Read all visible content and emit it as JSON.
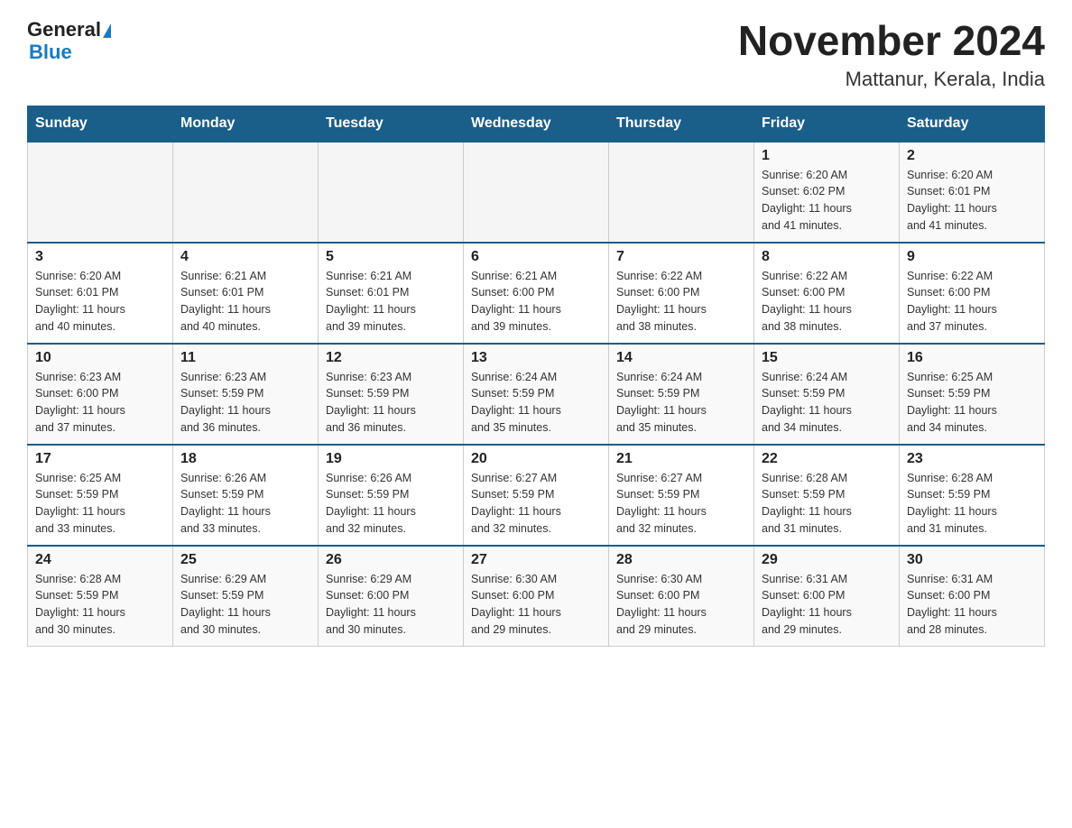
{
  "logo": {
    "text1": "General",
    "text2": "Blue"
  },
  "title": "November 2024",
  "subtitle": "Mattanur, Kerala, India",
  "weekdays": [
    "Sunday",
    "Monday",
    "Tuesday",
    "Wednesday",
    "Thursday",
    "Friday",
    "Saturday"
  ],
  "weeks": [
    [
      {
        "day": "",
        "info": ""
      },
      {
        "day": "",
        "info": ""
      },
      {
        "day": "",
        "info": ""
      },
      {
        "day": "",
        "info": ""
      },
      {
        "day": "",
        "info": ""
      },
      {
        "day": "1",
        "info": "Sunrise: 6:20 AM\nSunset: 6:02 PM\nDaylight: 11 hours\nand 41 minutes."
      },
      {
        "day": "2",
        "info": "Sunrise: 6:20 AM\nSunset: 6:01 PM\nDaylight: 11 hours\nand 41 minutes."
      }
    ],
    [
      {
        "day": "3",
        "info": "Sunrise: 6:20 AM\nSunset: 6:01 PM\nDaylight: 11 hours\nand 40 minutes."
      },
      {
        "day": "4",
        "info": "Sunrise: 6:21 AM\nSunset: 6:01 PM\nDaylight: 11 hours\nand 40 minutes."
      },
      {
        "day": "5",
        "info": "Sunrise: 6:21 AM\nSunset: 6:01 PM\nDaylight: 11 hours\nand 39 minutes."
      },
      {
        "day": "6",
        "info": "Sunrise: 6:21 AM\nSunset: 6:00 PM\nDaylight: 11 hours\nand 39 minutes."
      },
      {
        "day": "7",
        "info": "Sunrise: 6:22 AM\nSunset: 6:00 PM\nDaylight: 11 hours\nand 38 minutes."
      },
      {
        "day": "8",
        "info": "Sunrise: 6:22 AM\nSunset: 6:00 PM\nDaylight: 11 hours\nand 38 minutes."
      },
      {
        "day": "9",
        "info": "Sunrise: 6:22 AM\nSunset: 6:00 PM\nDaylight: 11 hours\nand 37 minutes."
      }
    ],
    [
      {
        "day": "10",
        "info": "Sunrise: 6:23 AM\nSunset: 6:00 PM\nDaylight: 11 hours\nand 37 minutes."
      },
      {
        "day": "11",
        "info": "Sunrise: 6:23 AM\nSunset: 5:59 PM\nDaylight: 11 hours\nand 36 minutes."
      },
      {
        "day": "12",
        "info": "Sunrise: 6:23 AM\nSunset: 5:59 PM\nDaylight: 11 hours\nand 36 minutes."
      },
      {
        "day": "13",
        "info": "Sunrise: 6:24 AM\nSunset: 5:59 PM\nDaylight: 11 hours\nand 35 minutes."
      },
      {
        "day": "14",
        "info": "Sunrise: 6:24 AM\nSunset: 5:59 PM\nDaylight: 11 hours\nand 35 minutes."
      },
      {
        "day": "15",
        "info": "Sunrise: 6:24 AM\nSunset: 5:59 PM\nDaylight: 11 hours\nand 34 minutes."
      },
      {
        "day": "16",
        "info": "Sunrise: 6:25 AM\nSunset: 5:59 PM\nDaylight: 11 hours\nand 34 minutes."
      }
    ],
    [
      {
        "day": "17",
        "info": "Sunrise: 6:25 AM\nSunset: 5:59 PM\nDaylight: 11 hours\nand 33 minutes."
      },
      {
        "day": "18",
        "info": "Sunrise: 6:26 AM\nSunset: 5:59 PM\nDaylight: 11 hours\nand 33 minutes."
      },
      {
        "day": "19",
        "info": "Sunrise: 6:26 AM\nSunset: 5:59 PM\nDaylight: 11 hours\nand 32 minutes."
      },
      {
        "day": "20",
        "info": "Sunrise: 6:27 AM\nSunset: 5:59 PM\nDaylight: 11 hours\nand 32 minutes."
      },
      {
        "day": "21",
        "info": "Sunrise: 6:27 AM\nSunset: 5:59 PM\nDaylight: 11 hours\nand 32 minutes."
      },
      {
        "day": "22",
        "info": "Sunrise: 6:28 AM\nSunset: 5:59 PM\nDaylight: 11 hours\nand 31 minutes."
      },
      {
        "day": "23",
        "info": "Sunrise: 6:28 AM\nSunset: 5:59 PM\nDaylight: 11 hours\nand 31 minutes."
      }
    ],
    [
      {
        "day": "24",
        "info": "Sunrise: 6:28 AM\nSunset: 5:59 PM\nDaylight: 11 hours\nand 30 minutes."
      },
      {
        "day": "25",
        "info": "Sunrise: 6:29 AM\nSunset: 5:59 PM\nDaylight: 11 hours\nand 30 minutes."
      },
      {
        "day": "26",
        "info": "Sunrise: 6:29 AM\nSunset: 6:00 PM\nDaylight: 11 hours\nand 30 minutes."
      },
      {
        "day": "27",
        "info": "Sunrise: 6:30 AM\nSunset: 6:00 PM\nDaylight: 11 hours\nand 29 minutes."
      },
      {
        "day": "28",
        "info": "Sunrise: 6:30 AM\nSunset: 6:00 PM\nDaylight: 11 hours\nand 29 minutes."
      },
      {
        "day": "29",
        "info": "Sunrise: 6:31 AM\nSunset: 6:00 PM\nDaylight: 11 hours\nand 29 minutes."
      },
      {
        "day": "30",
        "info": "Sunrise: 6:31 AM\nSunset: 6:00 PM\nDaylight: 11 hours\nand 28 minutes."
      }
    ]
  ]
}
